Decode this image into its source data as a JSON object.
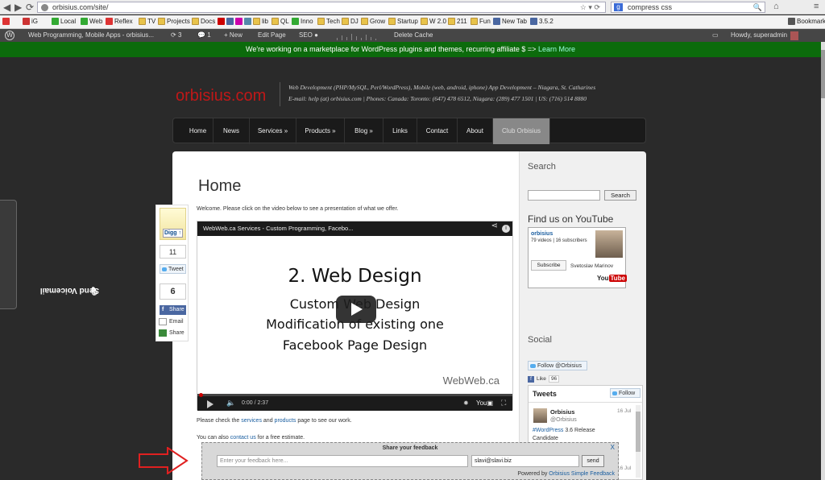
{
  "browser": {
    "url": "orbisius.com/site/",
    "search_value": "compress css",
    "search_engine": "g",
    "bookmarks_label": "Bookmark"
  },
  "bookmarks": [
    {
      "label": "",
      "icon": "gmail-icon",
      "color": "#d33"
    },
    {
      "label": "iG",
      "icon": "ig-icon",
      "color": "#c33"
    },
    {
      "label": "Local",
      "icon": "local-icon",
      "color": "#3a3"
    },
    {
      "label": "Web",
      "icon": "web-icon",
      "color": "#3a3"
    },
    {
      "label": "Reflex",
      "icon": "reflex-icon",
      "color": "#d33"
    },
    {
      "label": "TV",
      "icon": "folder-icon",
      "color": "#e8c34a"
    },
    {
      "label": "Projects",
      "icon": "folder-icon",
      "color": "#e8c34a"
    },
    {
      "label": "Docs",
      "icon": "folder-icon",
      "color": "#e8c34a"
    },
    {
      "label": "lib",
      "icon": "folder-icon",
      "color": "#e8c34a"
    },
    {
      "label": "QL",
      "icon": "folder-icon",
      "color": "#e8c34a"
    },
    {
      "label": "Inno",
      "icon": "inno-icon",
      "color": "#3a3"
    },
    {
      "label": "Tech",
      "icon": "folder-icon",
      "color": "#e8c34a"
    },
    {
      "label": "DJ",
      "icon": "folder-icon",
      "color": "#e8c34a"
    },
    {
      "label": "Grow",
      "icon": "folder-icon",
      "color": "#e8c34a"
    },
    {
      "label": "Startup",
      "icon": "folder-icon",
      "color": "#e8c34a"
    },
    {
      "label": "W 2.0",
      "icon": "folder-icon",
      "color": "#e8c34a"
    },
    {
      "label": "211",
      "icon": "folder-icon",
      "color": "#e8c34a"
    },
    {
      "label": "Fun",
      "icon": "folder-icon",
      "color": "#e8c34a"
    },
    {
      "label": "New Tab",
      "icon": "facebook-icon",
      "color": "#4a67a1"
    },
    {
      "label": "3.5.2",
      "icon": "wp-icon",
      "color": "#4a67a1"
    }
  ],
  "wpbar": {
    "site_name": "Web Programming, Mobile Apps - orbisius...",
    "updates": "3",
    "comments": "1",
    "new_label": "+ New",
    "edit_page": "Edit Page",
    "seo": "SEO",
    "delete_cache": "Delete Cache",
    "howdy": "Howdy, superadmin"
  },
  "banner": {
    "text": "We're working on a marketplace for WordPress plugins and themes, recurring affiliate $ =>",
    "link": "Learn More"
  },
  "site": {
    "logo": "orbisius.com",
    "tagline1": "Web Development (PHP/MySQL, Perl/WordPress), Mobile (web, android, iphone) App Development – Niagara, St. Catharines",
    "tagline2": "E-mail: help (at) orbisius.com | Phones: Canada: Toronto: (647) 478 6512, Niagara: (289) 477 1501 | US: (716) 514 8880"
  },
  "menu": {
    "items": [
      "Home",
      "News",
      "Services »",
      "Products »",
      "Blog »",
      "Links",
      "Contact",
      "About",
      "Club Orbisius"
    ]
  },
  "page": {
    "title": "Home",
    "welcome": "Welcome. Please click on the video below to see a presentation of what we offer.",
    "para1_pre": "Please check the",
    "para1_link1": "services",
    "para1_mid": "and",
    "para1_link2": "products",
    "para1_post": "page to see our work.",
    "para2_pre": "You can also",
    "para2_link": "contact us",
    "para2_post": "for a free estimate."
  },
  "video": {
    "title": "WebWeb.ca Services - Custom Programming, Facebo...",
    "line1": "2. Web Design",
    "line2": "Custom Web Design",
    "line3": "Modification of existing one",
    "line4": "Facebook Page Design",
    "brand": "WebWeb.ca",
    "time": "0:00 / 2:37",
    "progress": 0.0
  },
  "social": {
    "digg_label": "Digg",
    "tweet_count": "11",
    "tweet_label": "Tweet",
    "fb_count": "6",
    "fb_share": "Share",
    "email_label": "Email",
    "share_label": "Share"
  },
  "voicemail": {
    "label": "Send Voicemail"
  },
  "sidebar": {
    "search_title": "Search",
    "search_button": "Search",
    "youtube_title": "Find us on YouTube",
    "yt_channel": "orbisius",
    "yt_stats": "79 videos | 16 subscribers",
    "yt_subscribe": "Subscribe",
    "yt_owner": "Svetoslav Marinov",
    "yt_logo_a": "You",
    "yt_logo_b": "Tube",
    "social_title": "Social",
    "follow_label": "Follow @Orbisius",
    "like_label": "Like",
    "like_count": "96",
    "tweets_header": "Tweets",
    "tweets_follow": "Follow",
    "tweet_name": "Orbisius",
    "tweet_handle": "@Orbisius",
    "tweet_date": "16 Jul",
    "tweet_hash": "#WordPress",
    "tweet_text": "3.6 Release Candidate",
    "tweet_date2": "16 Jul"
  },
  "feedback": {
    "title": "Share your feedback",
    "close": "X",
    "placeholder": "Enter your feedback here...",
    "email": "slavi@slavi.biz",
    "send": "send",
    "powered_pre": "Powered by",
    "powered_link": "Orbisius Simple Feedback"
  }
}
